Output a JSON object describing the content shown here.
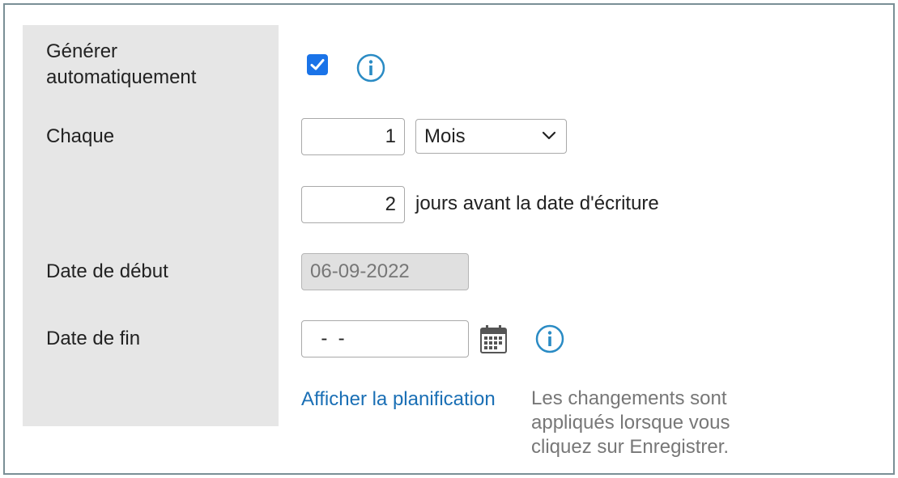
{
  "form": {
    "auto_generate_label": "Générer automatiquement",
    "auto_generate_checked": true,
    "every_label": "Chaque",
    "every_value": "1",
    "period_selected": "Mois",
    "days_before_value": "2",
    "days_before_text": "jours avant la date d'écriture",
    "start_date_label": "Date de début",
    "start_date_value": "06-09-2022",
    "end_date_label": "Date de fin",
    "end_date_value": "  -  -",
    "show_schedule_link": "Afficher la planification",
    "note_text": "Les changements sont appliqués lorsque vous cliquez sur Enregistrer."
  },
  "colors": {
    "accent": "#1a73e8",
    "link": "#1a6fb5",
    "info_icon": "#2a8bc4",
    "label_background": "#e6e6e6"
  }
}
